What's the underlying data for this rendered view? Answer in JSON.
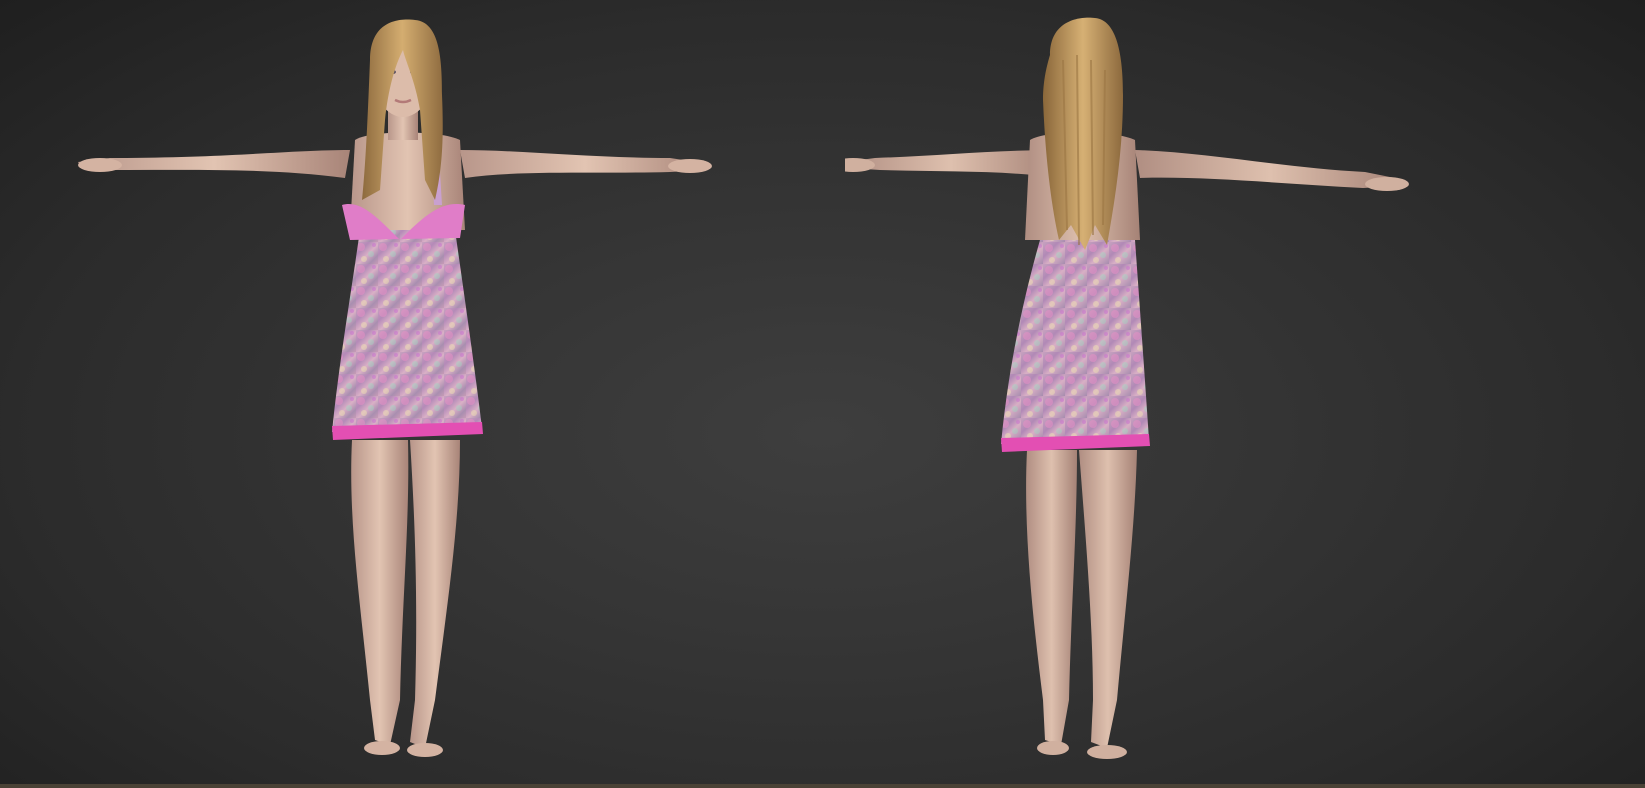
{
  "scene": {
    "background_color": "#353535",
    "views": [
      {
        "id": "front",
        "facing": "front"
      },
      {
        "id": "back",
        "facing": "back"
      }
    ],
    "character": {
      "pose": "T-pose",
      "hair_color": "#c9a063",
      "skin_color": "#d8b9a5",
      "dress_color": "#c99ab8",
      "dress_trim_color": "#e34fb3",
      "bodice_color": "#e07dc8"
    }
  }
}
